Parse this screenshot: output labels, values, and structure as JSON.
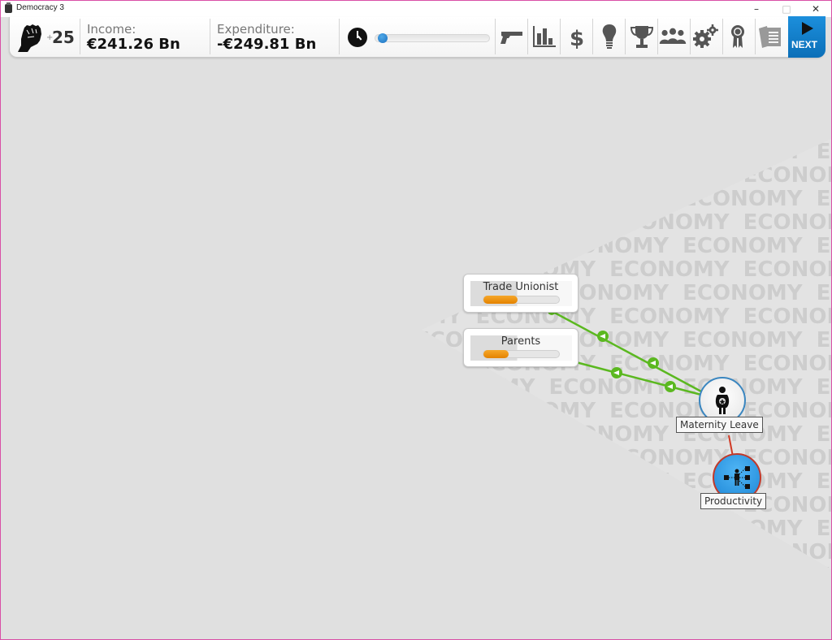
{
  "window": {
    "title": "Democracy 3",
    "controls": {
      "minimize": "–",
      "maximize": "□",
      "close": "✕"
    }
  },
  "toolbar": {
    "political_capital": {
      "icon": "raised-fist-icon",
      "plus": "+",
      "value": "25"
    },
    "income": {
      "label": "Income:",
      "value": "€241.26 Bn"
    },
    "expenditure": {
      "label": "Expenditure:",
      "value": "-€249.81 Bn"
    },
    "turn_progress": {
      "icon": "clock-icon",
      "fraction": 0.02
    },
    "icons": [
      {
        "name": "gun-icon",
        "meaning": "crime"
      },
      {
        "name": "bar-chart-icon",
        "meaning": "statistics"
      },
      {
        "name": "dollar-icon",
        "meaning": "finance"
      },
      {
        "name": "lightbulb-icon",
        "meaning": "ideas"
      },
      {
        "name": "trophy-icon",
        "meaning": "achievements"
      },
      {
        "name": "people-icon",
        "meaning": "voters"
      },
      {
        "name": "gears-icon",
        "meaning": "options"
      },
      {
        "name": "award-ribbon-icon",
        "meaning": "ribbon"
      },
      {
        "name": "documents-icon",
        "meaning": "reports"
      }
    ],
    "next_label": "NEXT"
  },
  "map": {
    "watermark": "ECONOMY",
    "groups": [
      {
        "name": "Trade Unionist",
        "membership": 0.45
      },
      {
        "name": "Parents",
        "membership": 0.33
      }
    ],
    "policy": {
      "name": "Maternity Leave",
      "icon": "pregnant-woman-icon"
    },
    "statistic": {
      "name": "Productivity",
      "icon": "worker-productivity-icon"
    },
    "colors": {
      "positive_link": "#5bb820",
      "negative_link": "#d03a25",
      "policy_ring": "#3a86c0",
      "statistic_fill": "#2b9ae8",
      "statistic_ring": "#c0392b",
      "group_bar": "#f0900e",
      "next_button": "#1383cf"
    }
  }
}
